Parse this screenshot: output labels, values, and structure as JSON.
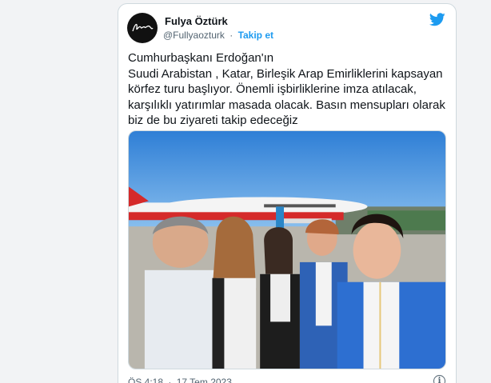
{
  "tweet": {
    "author_name": "Fulya Öztürk",
    "author_handle": "@Fullyaozturk",
    "separator": "·",
    "follow_label": "Takip et",
    "text": "Cumhurbaşkanı Erdoğan'ın\nSuudi Arabistan , Katar, Birleşik Arap Emirliklerini kapsayan körfez turu başlıyor. Önemli işbirliklerine imza atılacak, karşılıklı yatırımlar masada olacak. Basın mensupları olarak biz de bu ziyareti takip edeceğiz",
    "time": "ÖS 4:18",
    "date": "17 Tem 2023",
    "info_glyph": "i"
  },
  "icons": {
    "brand": "twitter-bird-icon",
    "info": "info-icon",
    "avatar": "signature-logo"
  },
  "colors": {
    "accent": "#1d9bf0",
    "text": "#0f1419",
    "muted": "#536471",
    "border": "#cfd9de"
  }
}
